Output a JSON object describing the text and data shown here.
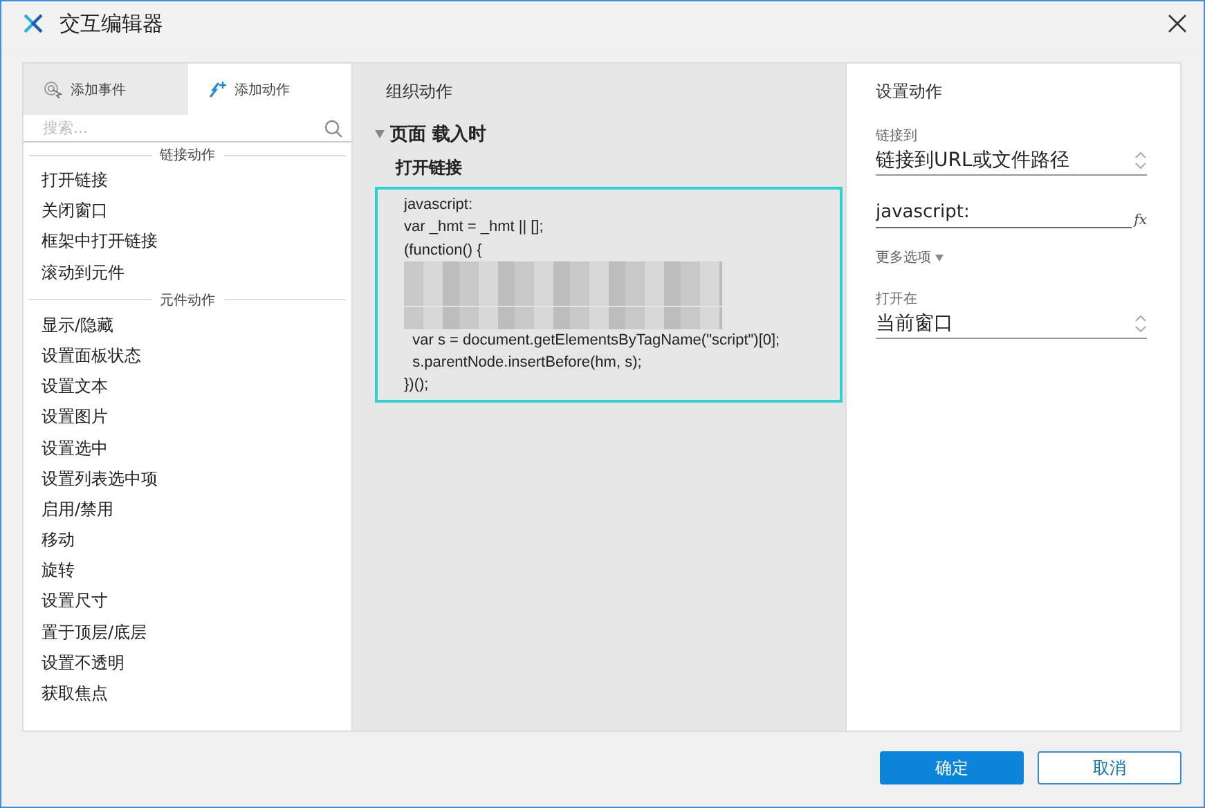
{
  "window": {
    "title": "交互编辑器"
  },
  "tabs": [
    {
      "label": "添加事件",
      "selected": false
    },
    {
      "label": "添加动作",
      "selected": true
    }
  ],
  "search": {
    "placeholder": "搜索..."
  },
  "action_groups": [
    {
      "title": "链接动作",
      "items": [
        "打开链接",
        "关闭窗口",
        "框架中打开链接",
        "滚动到元件"
      ]
    },
    {
      "title": "元件动作",
      "items": [
        "显示/隐藏",
        "设置面板状态",
        "设置文本",
        "设置图片",
        "设置选中",
        "设置列表选中项",
        "启用/禁用",
        "移动",
        "旋转",
        "设置尺寸",
        "置于顶层/底层",
        "设置不透明",
        "获取焦点"
      ]
    }
  ],
  "organize": {
    "title": "组织动作",
    "event": "页面 载入时",
    "expanded": true,
    "action": "打开链接",
    "code_lines": [
      {
        "kind": "code",
        "text": "javascript:"
      },
      {
        "kind": "code",
        "text": "var _hmt = _hmt || [];"
      },
      {
        "kind": "code",
        "text": "(function() {"
      },
      {
        "kind": "redacted"
      },
      {
        "kind": "redacted"
      },
      {
        "kind": "redacted"
      },
      {
        "kind": "code",
        "text": "  var s = document.getElementsByTagName(\"script\")[0];"
      },
      {
        "kind": "code",
        "text": "  s.parentNode.insertBefore(hm, s);"
      },
      {
        "kind": "code",
        "text": "})();"
      }
    ]
  },
  "settings": {
    "title": "设置动作",
    "link_label": "链接到",
    "link_value": "链接到URL或文件路径",
    "url_value": "javascript:",
    "fx": "fx",
    "more": "更多选项",
    "more_expanded": false,
    "open_label": "打开在",
    "open_value": "当前窗口"
  },
  "buttons": [
    {
      "label": "确定",
      "kind": "primary"
    },
    {
      "label": "取消",
      "kind": "secondary"
    }
  ]
}
